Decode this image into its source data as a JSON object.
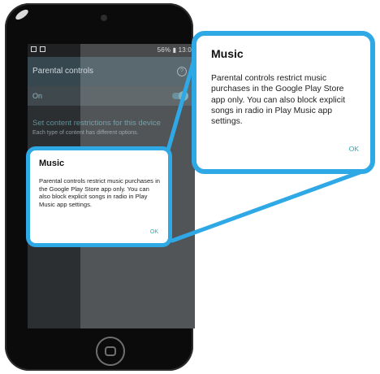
{
  "statusbar": {
    "right_text": "56% ▮ 13:0"
  },
  "actionbar": {
    "title": "Parental controls"
  },
  "switch_row": {
    "label": "On"
  },
  "section": {
    "title": "Set content restrictions for this device",
    "subtitle": "Each type of content has different options."
  },
  "dialog": {
    "title": "Music",
    "body": "Parental controls restrict music purchases in the Google Play Store app only. You can also block explicit songs in radio in Play Music app settings.",
    "ok_label": "OK"
  },
  "colors": {
    "callout": "#2fa8e6",
    "accent": "#2aa7b0"
  },
  "icons": [
    "help-icon",
    "notification-icon",
    "image-icon",
    "home-button-icon"
  ]
}
